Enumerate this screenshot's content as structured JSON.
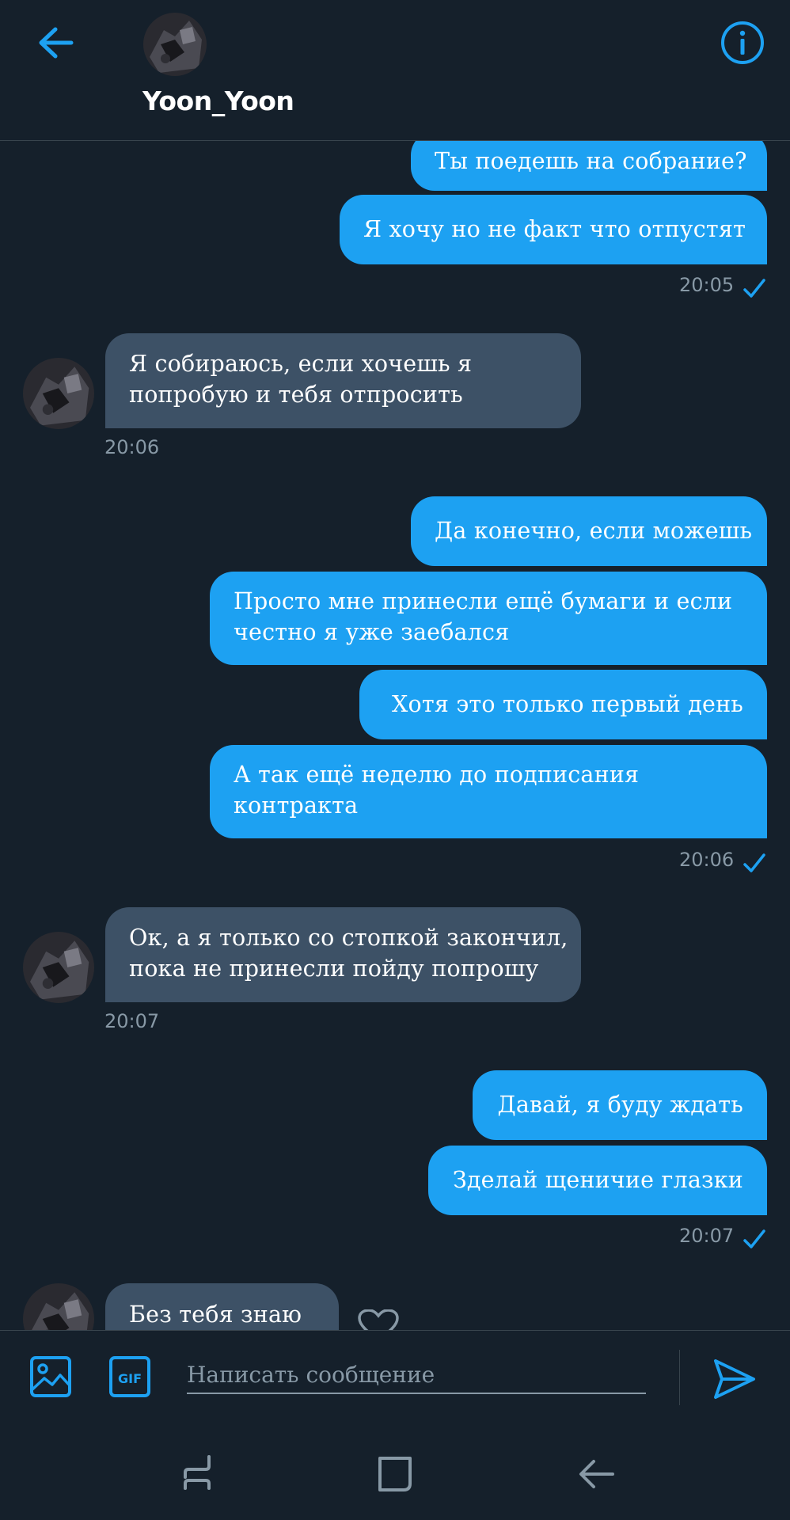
{
  "header": {
    "contact_name": "Yoon_Yoon"
  },
  "messages": [
    {
      "text": "Ты поедешь на собрание?"
    },
    {
      "text": "Я хочу но не факт что отпустят"
    },
    {
      "time": "20:05"
    },
    {
      "line1": "Я собираюсь, если хочешь я",
      "line2": "попробую и тебя отпросить"
    },
    {
      "time": "20:06"
    },
    {
      "text": "Да конечно, если можешь"
    },
    {
      "line1": "Просто мне принесли ещё бумаги и если",
      "line2": "честно я уже заебался"
    },
    {
      "text": "Хотя это только первый день"
    },
    {
      "line1": "А так ещё неделю до подписания",
      "line2": "контракта"
    },
    {
      "time": "20:06"
    },
    {
      "line1": "Ок, а я только со стопкой закончил,",
      "line2": "пока не принесли пойду попрошу"
    },
    {
      "time": "20:07"
    },
    {
      "text": "Давай, я буду ждать"
    },
    {
      "text": "Зделай щеничие глазки"
    },
    {
      "time": "20:07"
    },
    {
      "text": "Без тебя знаю"
    }
  ],
  "compose": {
    "placeholder": "Написать сообщение",
    "gif_label": "GIF"
  },
  "colors": {
    "accent": "#1da1f2",
    "background": "#15202b",
    "incoming": "#3d5166",
    "muted": "#8899a6"
  },
  "icons": [
    "back-arrow-icon",
    "info-icon",
    "check-icon",
    "heart-icon",
    "image-icon",
    "gif-icon",
    "send-icon",
    "recent-apps-icon",
    "home-icon",
    "back-icon"
  ]
}
